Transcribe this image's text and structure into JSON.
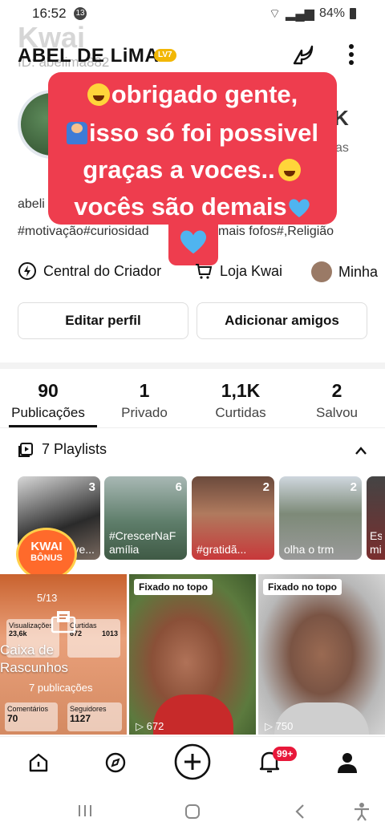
{
  "status": {
    "time": "16:52",
    "notif_count": "13",
    "battery": "84%"
  },
  "watermark": {
    "logo": "Kwai",
    "id": "ID: abelima882"
  },
  "profile": {
    "username": "ABEL DE LiMA",
    "level": "LV7",
    "bg_right_1": "K",
    "bg_right_2": "as",
    "bio_prefix": "abeli",
    "tags": "#motivação#curiosidad",
    "tags_tail": "mais fofos#,Religião"
  },
  "overlay": {
    "line1": "obrigado gente,",
    "line2": "isso só foi possivel",
    "line3": "graças a voces..",
    "line4": "vocês  são  demais"
  },
  "creator_row": {
    "central": "Central do Criador",
    "loja": "Loja Kwai",
    "minha": "Minha"
  },
  "buttons": {
    "edit": "Editar perfil",
    "add": "Adicionar amigos"
  },
  "stats": [
    {
      "num": "90",
      "label": "Publicações"
    },
    {
      "num": "1",
      "label": "Privado"
    },
    {
      "num": "1,1K",
      "label": "Curtidas"
    },
    {
      "num": "2",
      "label": "Salvou"
    }
  ],
  "playlists_header": "7 Playlists",
  "playlists": [
    {
      "count": "3",
      "title": "#...ve..."
    },
    {
      "count": "6",
      "title": "#CrescerNaF amília"
    },
    {
      "count": "2",
      "title": "#gratidã..."
    },
    {
      "count": "2",
      "title": "olha o trm"
    },
    {
      "count": "",
      "title": "Es mi"
    }
  ],
  "bonus": {
    "line1": "KWAI",
    "line2": "BÔNUS"
  },
  "drafts": {
    "label": "Caixa de Rascunhos",
    "count": "7 publicações",
    "page": "5/13",
    "stat_a_label": "Visualizações",
    "stat_a_val": "23,6k",
    "stat_b_label": "Curtidas",
    "stat_b_val": "672",
    "stat_c_val": "1013",
    "comments_label": "Comentários",
    "comments_val": "70",
    "followers_label": "Seguidores",
    "followers_val": "1127"
  },
  "videos": [
    {
      "pin": "Fixado no topo",
      "views": "672"
    },
    {
      "pin": "Fixado no topo",
      "views": "750"
    }
  ],
  "nav": {
    "badge": "99+"
  },
  "colors": {
    "overlay": "#ee3d4e",
    "accent": "#fe2c55"
  }
}
